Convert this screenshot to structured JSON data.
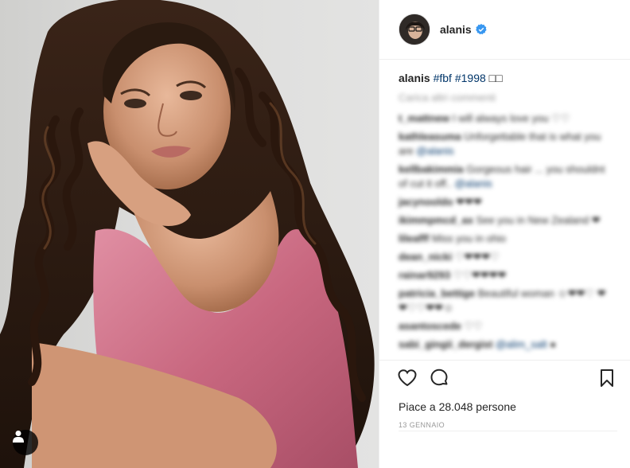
{
  "post": {
    "username": "alanis",
    "verified": true,
    "caption": {
      "username": "alanis",
      "tags": "#fbf #1998",
      "emoji": "□□"
    },
    "load_more": "Carica altri commenti",
    "comments": [
      {
        "user": "t_mattnew",
        "text": " I will always love you ♡♡"
      },
      {
        "user": "kathleasuma",
        "text": " Unforgettable that is what you are ",
        "mention": "@alanis"
      },
      {
        "user": "kellbakimmia",
        "text": " Gorgeous hair ... you shouldnt of cut it off.. ",
        "mention": "@alanis"
      },
      {
        "user": "jacynooldo",
        "text": " ❤❤❤"
      },
      {
        "user": "ikimmpmcd_ax",
        "text": " See you in New Zealand ❤"
      },
      {
        "user": "lileafff",
        "text": " Miss you in ohio"
      },
      {
        "user": "dean_nicki",
        "text": " ♡❤❤❤♡"
      },
      {
        "user": "rainar9293",
        "text": " ♡♡❤❤❤❤"
      },
      {
        "user": "patricia_bettige",
        "text": " Beautiful woman ☺❤❤♡ ❤❤♡♡❤❤☺"
      },
      {
        "user": "asantoscede",
        "text": " ♡♡"
      },
      {
        "user": "sabi_gingii_dergist",
        "text": " ",
        "mention": "@alim_salt",
        "tail": " ●"
      }
    ],
    "likes_text": "Piace a 28.048 persone",
    "date": "13 GENNAIO"
  },
  "icons": {
    "like": "heart-icon",
    "comment": "comment-bubble-icon",
    "save": "bookmark-icon",
    "verified": "verified-badge-icon",
    "tag": "user-tag-icon"
  },
  "colors": {
    "verified_blue": "#3897f0",
    "link_blue": "#003569",
    "muted": "#999999",
    "border": "#efefef"
  }
}
